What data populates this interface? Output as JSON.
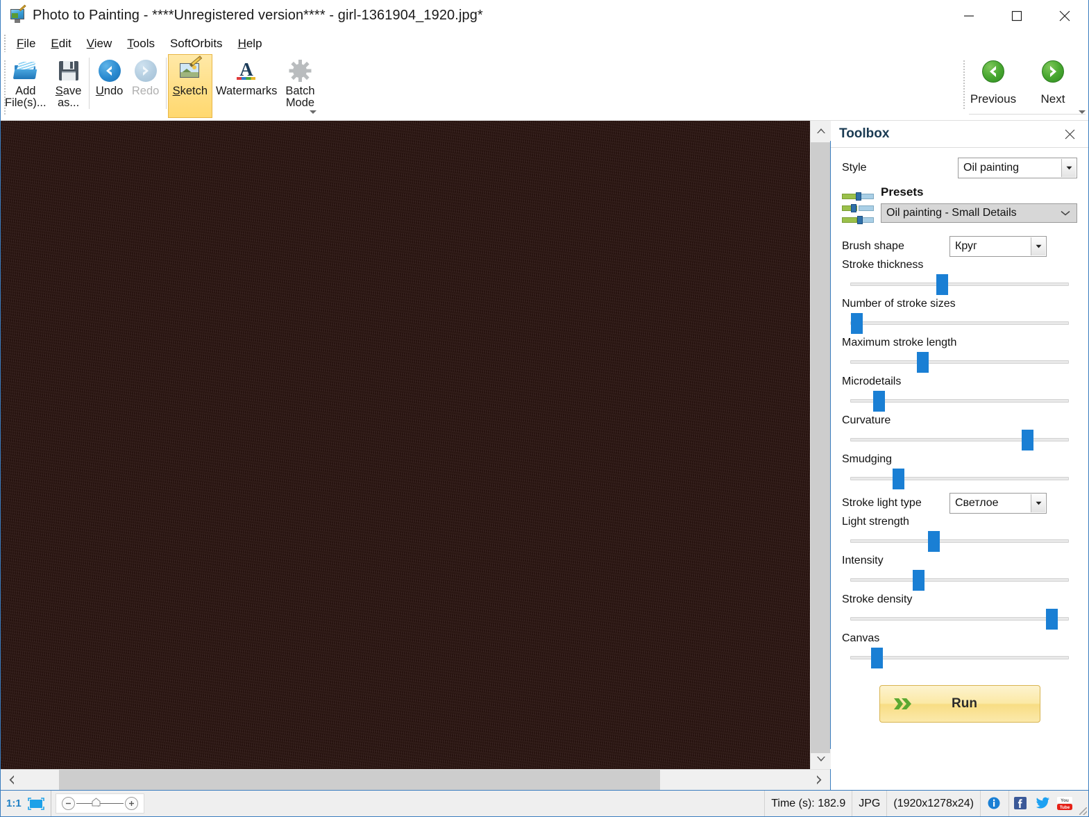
{
  "window": {
    "title": "Photo to Painting - ****Unregistered version**** - girl-1361904_1920.jpg*",
    "icon": "app-icon",
    "minimize": "minimize-icon",
    "maximize": "maximize-icon",
    "close": "close-icon"
  },
  "menubar": {
    "items": [
      {
        "label": "File",
        "accel": "F"
      },
      {
        "label": "Edit",
        "accel": "E"
      },
      {
        "label": "View",
        "accel": "V"
      },
      {
        "label": "Tools",
        "accel": "T"
      },
      {
        "label": "SoftOrbits",
        "accel": ""
      },
      {
        "label": "Help",
        "accel": "H"
      }
    ]
  },
  "toolbar": {
    "add_files": "Add\nFile(s)...",
    "save_as": "Save\nas...",
    "undo": "Undo",
    "redo": "Redo",
    "sketch": "Sketch",
    "watermarks": "Watermarks",
    "batch_mode": "Batch\nMode",
    "previous": "Previous",
    "next": "Next"
  },
  "toolbox": {
    "title": "Toolbox",
    "style_label": "Style",
    "style_value": "Oil painting",
    "presets_label": "Presets",
    "presets_value": "Oil painting - Small Details",
    "brush_shape_label": "Brush shape",
    "brush_shape_value": "Круг",
    "stroke_light_type_label": "Stroke light type",
    "stroke_light_type_value": "Светлое",
    "run_label": "Run",
    "sliders": [
      {
        "label": "Stroke thickness",
        "percent": 42
      },
      {
        "label": "Number of stroke sizes",
        "percent": 3
      },
      {
        "label": "Maximum stroke length",
        "percent": 33
      },
      {
        "label": "Microdetails",
        "percent": 13
      },
      {
        "label": "Curvature",
        "percent": 81
      },
      {
        "label": "Smudging",
        "percent": 22
      },
      {
        "label": "Light strength",
        "percent": 38
      },
      {
        "label": "Intensity",
        "percent": 31
      },
      {
        "label": "Stroke density",
        "percent": 92
      },
      {
        "label": "Canvas",
        "percent": 12
      }
    ]
  },
  "statusbar": {
    "ratio": "1:1",
    "fit_icon": "fit-to-window-icon",
    "zoom_out_icon": "zoom-out-icon",
    "zoom_in_icon": "zoom-in-icon",
    "zoom_home_icon": "zoom-reset-icon",
    "time": "Time (s): 182.9",
    "format": "JPG",
    "dimensions": "(1920x1278x24)",
    "info_icon": "info-icon",
    "facebook_icon": "facebook-icon",
    "twitter_icon": "twitter-icon",
    "youtube_icon": "youtube-icon"
  },
  "colors": {
    "accent_blue": "#1a7fd4",
    "highlight_yellow": "#ffdf86",
    "green_nav": "#49a831",
    "title_blue": "#1a3a52"
  }
}
